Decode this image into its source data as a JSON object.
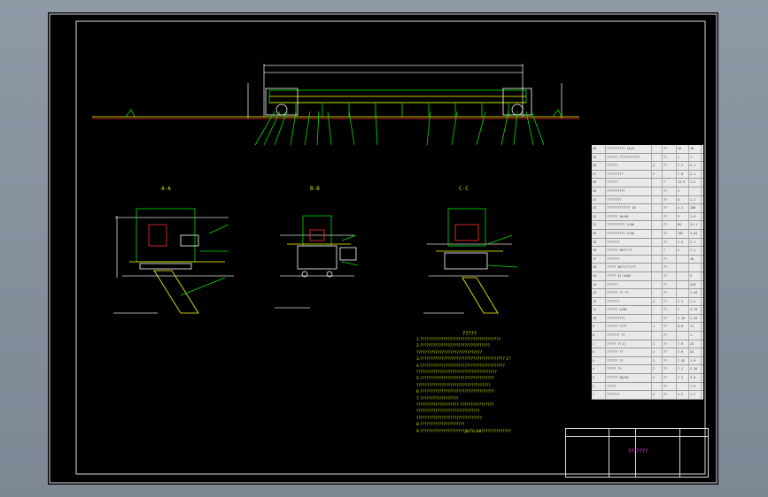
{
  "section_labels": [
    "A-A",
    "B-B",
    "C-C"
  ],
  "notes": {
    "title": "?????",
    "lines": [
      "1.??????????????????????????????????????",
      "2.?????????????????????????????????",
      "  ???????????????????????????????",
      "3.???????????????????????????????????????? 1?",
      "4.????????????????????????????????????????",
      "  ??????????????????????????????????????",
      "5.???????????????????????????????????",
      "  ???????????????????????????????????",
      "6.???????????????????????????????????",
      "7.??????????????????",
      "  ????????????????????  ????????????????",
      "  ??????????????????????????????",
      "  ???????????????????????????????",
      "8.?????????????????????",
      "9.?????????????????????JB/T6-68??????????????"
    ]
  },
  "parts_table": {
    "rows": [
      [
        "30",
        "?????????? 15/6",
        "",
        "??",
        "20",
        "16"
      ],
      [
        "29",
        "?????? ???????????",
        "",
        "??",
        "1",
        "1"
      ],
      [
        "28",
        "??????",
        "4",
        "??",
        "7.2",
        "2.1"
      ],
      [
        "27",
        "?????????",
        "2",
        "",
        "7.0",
        "2.1"
      ],
      [
        "26",
        "??????",
        "",
        "?",
        "13.9",
        "1.2"
      ],
      [
        "25",
        "??????????",
        "",
        "??",
        "1",
        ""
      ],
      [
        "24",
        "????????",
        "",
        "??",
        "8",
        "1.1"
      ],
      [
        "23",
        "????????????? 16",
        "",
        "??",
        "1.1",
        "100"
      ],
      [
        "22",
        "?????? 16/06",
        "",
        "??",
        "2",
        "1.8"
      ],
      [
        "21",
        "?????????? 1/06",
        "",
        "??",
        "65",
        "21.1"
      ],
      [
        "20",
        "?????????? 1/06",
        "",
        "??",
        "102",
        "3.61"
      ],
      [
        "19",
        "???????",
        "",
        "??",
        "2.5",
        "2.1"
      ],
      [
        "18",
        "?????? 30??/??",
        "",
        "?",
        "2",
        "7.1"
      ],
      [
        "17",
        "???????",
        "",
        "??",
        "",
        "16"
      ],
      [
        "16",
        "????? 30??/??/??",
        "",
        "??",
        "",
        ""
      ],
      [
        "15",
        "????? 31-1400",
        "",
        "??",
        "",
        "5"
      ],
      [
        "14",
        "??????",
        "",
        "??",
        "",
        "210"
      ],
      [
        "13",
        "?????? ?? ??",
        "",
        "??",
        "",
        "1.44"
      ],
      [
        "12",
        "???????",
        "4",
        "??",
        "1.1",
        "1.1"
      ],
      [
        "11",
        "?????? 1/60",
        "",
        "??",
        "2",
        "4.13"
      ],
      [
        "10",
        "??????????",
        "",
        "??",
        "1.15",
        "1.25"
      ],
      [
        "9",
        "?????? ????",
        "1",
        "??",
        "6.6",
        "11"
      ],
      [
        "8",
        "??????? ??",
        "",
        "??",
        "",
        "1"
      ],
      [
        "7",
        "????? ??-5",
        "1",
        "??",
        "7.9",
        "23"
      ],
      [
        "6",
        "?????? ??",
        "2",
        "??",
        "7.9",
        "23"
      ],
      [
        "5",
        "?????? ??",
        "2",
        "??",
        "7.42",
        "1.0"
      ],
      [
        "4",
        "????? ??",
        "2",
        "??",
        "?.1",
        "2.18"
      ],
      [
        "3",
        "?????? 30/30",
        "2",
        "??",
        "?.1",
        "3.0"
      ],
      [
        "2",
        "?????",
        "",
        "??",
        "",
        "1.5"
      ],
      [
        "1",
        "???????",
        "2",
        "??",
        "1.2",
        "1.2"
      ]
    ]
  },
  "title_block": {
    "drawing_name": "???????"
  }
}
